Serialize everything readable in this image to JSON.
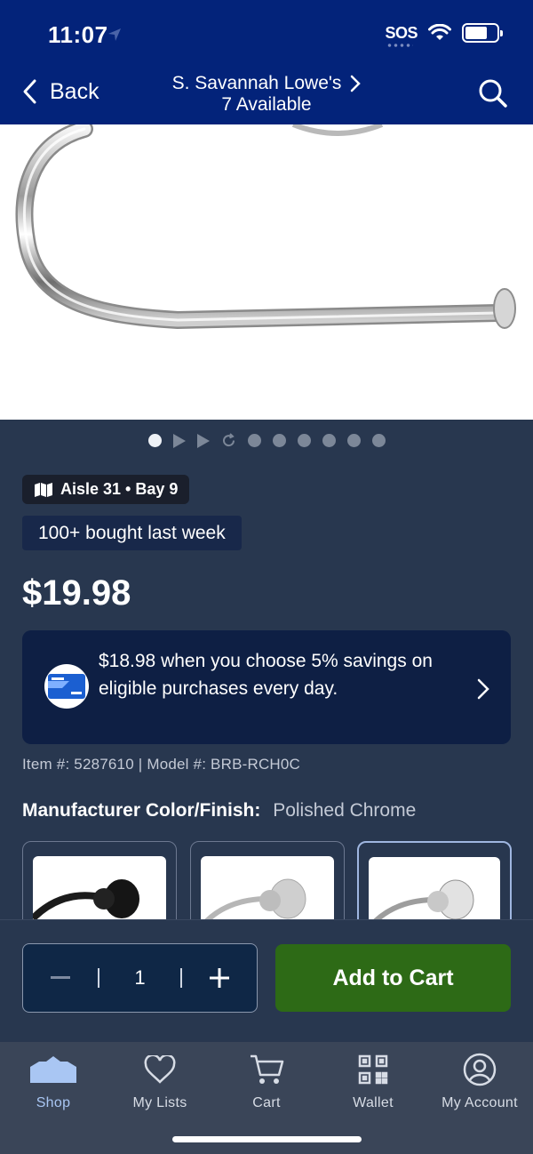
{
  "status_bar": {
    "time": "11:07",
    "sos": "SOS"
  },
  "header": {
    "back_label": "Back",
    "store_name": "S. Savannah Lowe's",
    "availability": "7 Available"
  },
  "product": {
    "aisle_badge": "Aisle 31 • Bay 9",
    "bought_badge": "100+ bought last week",
    "price": "$19.98",
    "promo_text": "$18.98 when you choose 5% savings on eligible purchases every day.",
    "item_info": "Item #: 5287610 | Model #: BRB-RCH0C",
    "color_label": "Manufacturer Color/Finish:",
    "color_value": "Polished Chrome",
    "swatches": [
      {
        "name": "matte-black",
        "selected": false
      },
      {
        "name": "brushed-nickel",
        "selected": false
      },
      {
        "name": "polished-chrome",
        "selected": true
      }
    ]
  },
  "carousel": {
    "active_index": 0,
    "total": 10
  },
  "actions": {
    "quantity": "1",
    "add_to_cart": "Add to Cart"
  },
  "tabs": [
    {
      "label": "Shop",
      "icon": "shop-icon",
      "active": true
    },
    {
      "label": "My Lists",
      "icon": "heart-icon",
      "active": false
    },
    {
      "label": "Cart",
      "icon": "cart-icon",
      "active": false
    },
    {
      "label": "Wallet",
      "icon": "qr-code-icon",
      "active": false
    },
    {
      "label": "My Account",
      "icon": "account-icon",
      "active": false
    }
  ],
  "colors": {
    "header_bg": "#03237a",
    "page_bg": "#28374f",
    "cta_green": "#2d6a16",
    "tab_active": "#a9c6f3"
  }
}
